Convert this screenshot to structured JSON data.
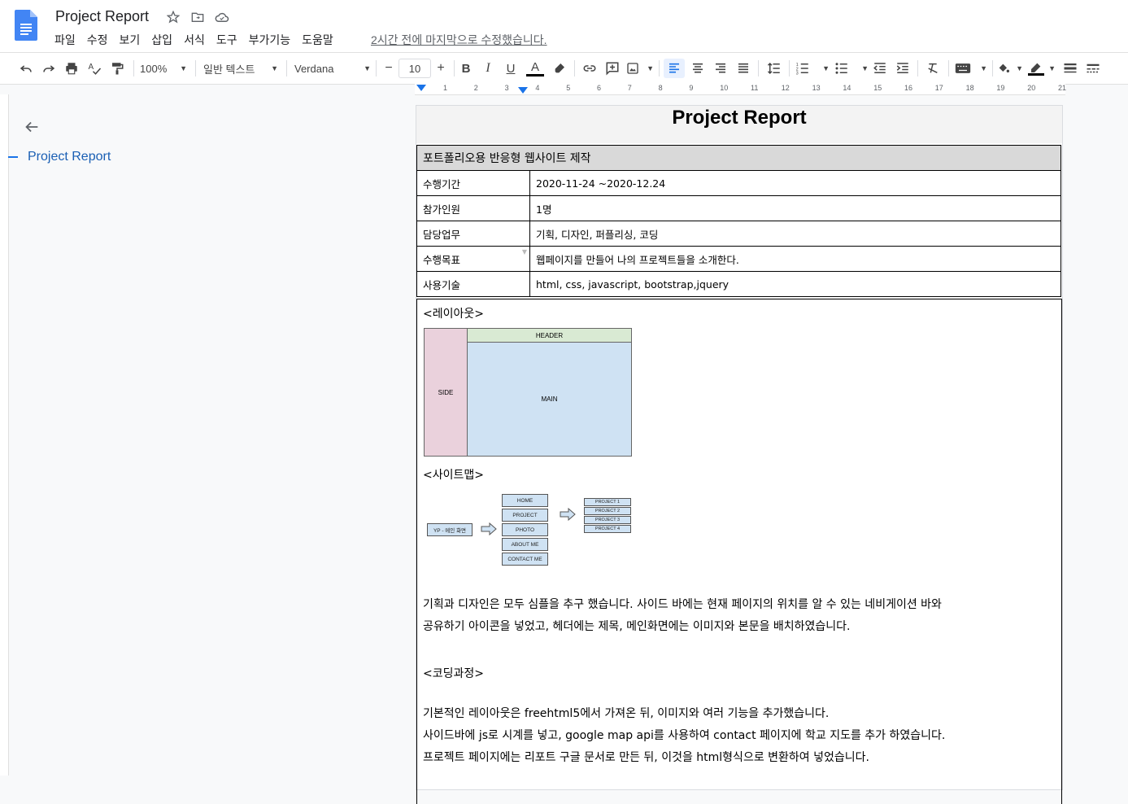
{
  "header": {
    "doc_title": "Project Report",
    "last_edit": "2시간 전에 마지막으로 수정했습니다."
  },
  "menu": [
    "파일",
    "수정",
    "보기",
    "삽입",
    "서식",
    "도구",
    "부가기능",
    "도움말"
  ],
  "toolbar": {
    "zoom": "100%",
    "style": "일반 텍스트",
    "font": "Verdana",
    "font_size": "10"
  },
  "outline": {
    "item": "Project Report"
  },
  "document": {
    "title": "Project Report",
    "table_header": "포트폴리오용 반응형 웹사이트 제작",
    "rows": [
      {
        "label": "수행기간",
        "value": "2020-11-24 ~2020-12.24"
      },
      {
        "label": "참가인원",
        "value": "1명"
      },
      {
        "label": "담당업무",
        "value": "기획, 디자인, 퍼플리싱, 코딩"
      },
      {
        "label": "수행목표",
        "value": "웹페이지를 만들어 나의 프로젝트들을 소개한다."
      },
      {
        "label": "사용기술",
        "value": "html, css, javascript, bootstrap,jquery"
      }
    ],
    "layout_heading": "<레이아웃>",
    "layout_diagram": {
      "side": "SIDE",
      "header": "HEADER",
      "main": "MAIN"
    },
    "sitemap_heading": "<사이트맵>",
    "sitemap": {
      "root": "YP - 메인 화면",
      "pages": [
        "HOME",
        "PROJECT",
        "PHOTO",
        "ABOUT ME",
        "CONTACT ME"
      ],
      "projects": [
        "PROJECT 1",
        "PROJECT 2",
        "PROJECT 3",
        "PROJECT 4"
      ]
    },
    "para1_line1": "기획과 디자인은 모두 심플을 추구 했습니다. 사이드 바에는 현재 페이지의 위치를 알 수 있는 네비게이션 바와",
    "para1_line2": "공유하기 아이콘을 넣었고, 헤더에는 제목, 메인화면에는 이미지와 본문을 배치하였습니다.",
    "coding_heading": "<코딩과정>",
    "para2_line1": "기본적인 레이아웃은 freehtml5에서 가져온 뒤, 이미지와 여러 기능을 추가했습니다.",
    "para2_line2": "사이드바에 js로 시계를 넣고, google map api를 사용하여 contact 페이지에 학교 지도를 추가 하였습니다.",
    "para2_line3": "프로젝트 페이지에는 리포트 구글 문서로 만든 뒤, 이것을 html형식으로 변환하여 넣었습니다."
  },
  "ruler_marks": [
    "1",
    "2",
    "3",
    "4",
    "5",
    "6",
    "7",
    "8",
    "9",
    "10",
    "11",
    "12",
    "13",
    "14",
    "15",
    "16",
    "17",
    "18",
    "19",
    "20",
    "21"
  ]
}
